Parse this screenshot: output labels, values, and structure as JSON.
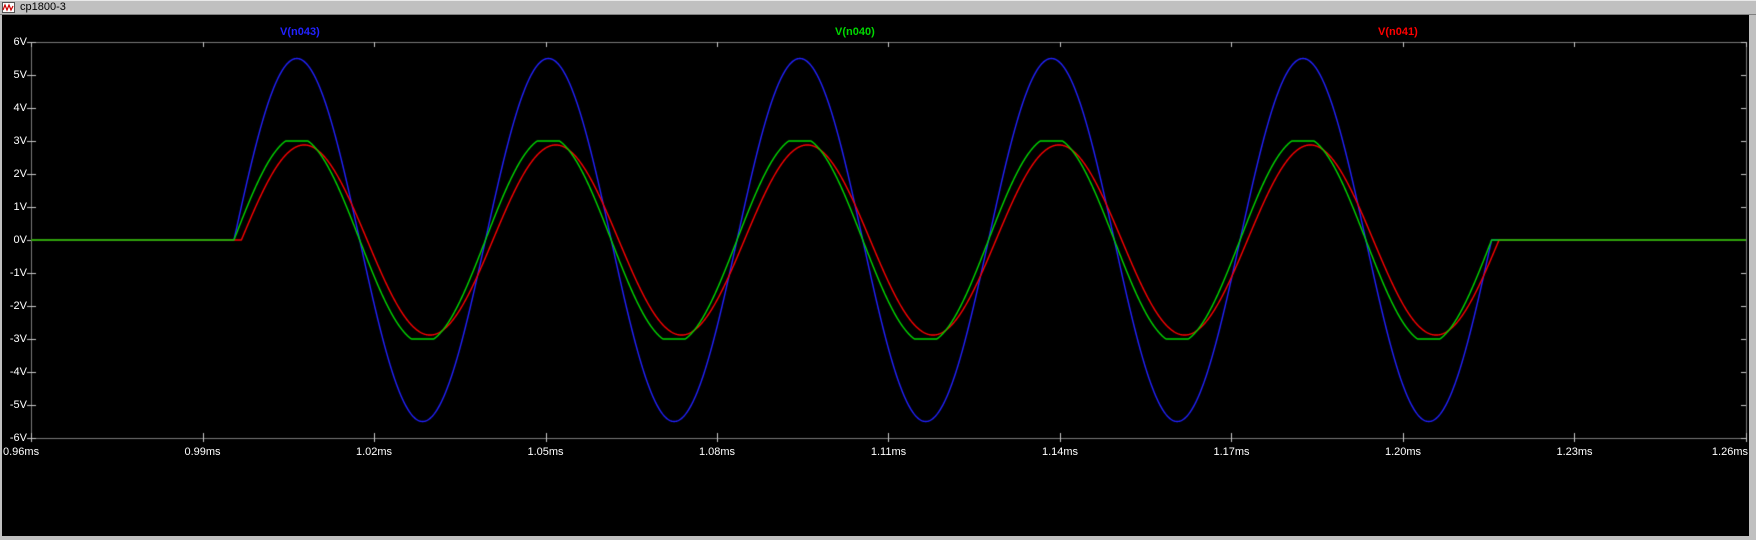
{
  "window": {
    "title": "cp1800-3"
  },
  "colors": {
    "chrome": "#c0c0c0",
    "plot_bg": "#000000",
    "text": "#ffffff",
    "plot_border": "#7a7a7a",
    "tick": "#c8c8c8"
  },
  "chart_data": {
    "type": "line",
    "title": "",
    "grid": false,
    "legend_position": "top",
    "x_axis": {
      "unit": "ms",
      "min": 0.96,
      "max": 1.26,
      "tick_step": 0.03,
      "tick_labels": [
        "0.96ms",
        "0.99ms",
        "1.02ms",
        "1.05ms",
        "1.08ms",
        "1.11ms",
        "1.14ms",
        "1.17ms",
        "1.20ms",
        "1.23ms",
        "1.26ms"
      ]
    },
    "y_axis": {
      "unit": "V",
      "min": -6,
      "max": 6,
      "tick_step": 1,
      "tick_labels": [
        "6V",
        "5V",
        "4V",
        "3V",
        "2V",
        "1V",
        "0V",
        "-1V",
        "-2V",
        "-3V",
        "-4V",
        "-5V",
        "-6V"
      ]
    },
    "series": [
      {
        "name": "V(n043)",
        "color": "#2222ff",
        "waveform": "sine_burst",
        "amplitude_V": 5.5,
        "clip_V": null,
        "phase_lag_ms": 0
      },
      {
        "name": "V(n040)",
        "color": "#00d800",
        "waveform": "sine_burst",
        "amplitude_V": 3.12,
        "clip_V": 3.0,
        "phase_lag_ms": 0
      },
      {
        "name": "V(n041)",
        "color": "#ff0000",
        "waveform": "sine_burst",
        "amplitude_V": 2.88,
        "clip_V": null,
        "phase_lag_ms": 0.0013
      }
    ],
    "burst": {
      "baseline_V": 0,
      "start_ms": 0.9955,
      "end_ms": 1.2155,
      "period_ms": 0.044,
      "cycles": 5,
      "approx_frequency_kHz": 22.7
    }
  }
}
